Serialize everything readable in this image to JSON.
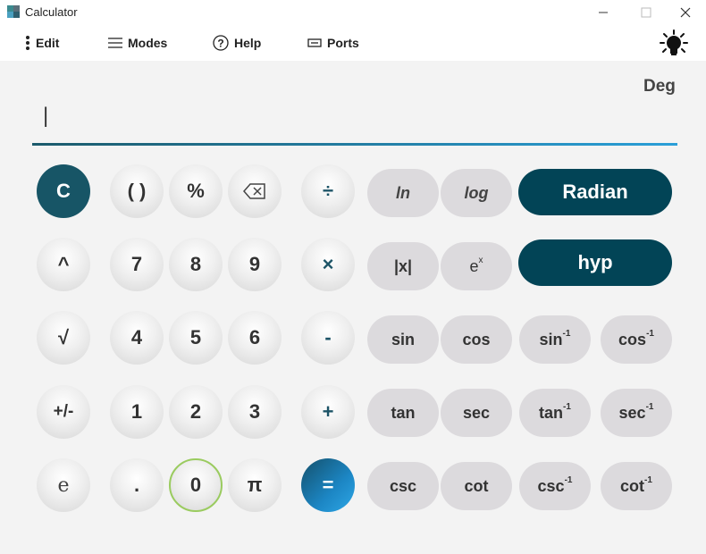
{
  "window": {
    "title": "Calculator",
    "minimize": "—",
    "maximize": "☐",
    "close": "✕"
  },
  "menu": {
    "edit": "Edit",
    "modes": "Modes",
    "help": "Help",
    "ports": "Ports"
  },
  "angle_mode": "Deg",
  "display": {
    "value": "|"
  },
  "keys": {
    "clear": "C",
    "paren": "( )",
    "percent": "%",
    "backspace": "⌫",
    "divide": "÷",
    "power": "^",
    "seven": "7",
    "eight": "8",
    "nine": "9",
    "multiply": "×",
    "sqrt": "√",
    "four": "4",
    "five": "5",
    "six": "6",
    "minus": "-",
    "negate": "+/-",
    "one": "1",
    "two": "2",
    "three": "3",
    "plus": "+",
    "euler": "e",
    "decimal": ".",
    "zero": "0",
    "pi": "π",
    "equals": "="
  },
  "functions": {
    "ln": "ln",
    "log": "log",
    "radian": "Radian",
    "abs": "|x|",
    "exp_base": "e",
    "exp_sup": "x",
    "hyp": "hyp",
    "sin": "sin",
    "cos": "cos",
    "asin": "sin",
    "acos": "cos",
    "tan": "tan",
    "sec": "sec",
    "atan": "tan",
    "asec": "sec",
    "csc": "csc",
    "cot": "cot",
    "acsc": "csc",
    "acot": "cot",
    "inverse_sup": "-1"
  }
}
